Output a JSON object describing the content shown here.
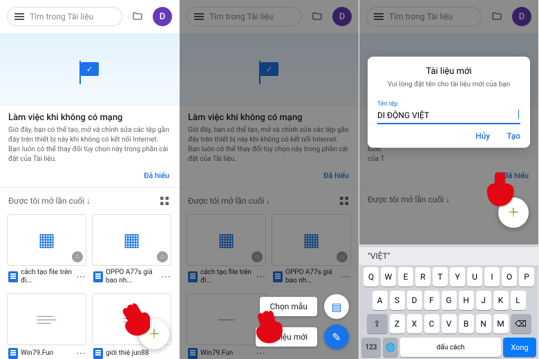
{
  "search_placeholder": "Tìm trong Tài liệu",
  "avatar_letter": "D",
  "hero": {
    "title": "Làm việc khi không có mạng",
    "body": "Giờ đây, bạn có thể tạo, mở và chỉnh sửa các tệp gần đây trên thiết bị này khi không có kết nối Internet. Bạn luôn có thể thay đổi tùy chọn này trong phần cài đặt của Tài liệu.",
    "got_it": "Đã hiểu"
  },
  "section_label": "Được tôi mở lần cuối ↓",
  "docs": [
    {
      "title": "cách tạo file trên đi..."
    },
    {
      "title": "OPPO A77s giá bao nh..."
    },
    {
      "title": "Win79.Fun"
    },
    {
      "title": "giới thiệ jun88"
    }
  ],
  "fab_menu": {
    "template": "Chọn mẫu",
    "new_doc": "Tài liệu mới"
  },
  "dialog": {
    "title": "Tài liệu mới",
    "subtitle": "Vui lòng đặt tên cho tài liệu mới của bạn",
    "field_label": "Tên tệp",
    "value": "DI ĐỘNG VIỆT",
    "cancel": "Hủy",
    "create": "Tạo"
  },
  "keyboard": {
    "suggestion": "\"VIỆT\"",
    "r1": [
      "Q",
      "W",
      "E",
      "R",
      "T",
      "Y",
      "U",
      "I",
      "O",
      "P"
    ],
    "r2": [
      "A",
      "S",
      "D",
      "F",
      "G",
      "H",
      "J",
      "K",
      "L"
    ],
    "r3": [
      "Z",
      "X",
      "C",
      "V",
      "B",
      "N",
      "M"
    ],
    "num": "123",
    "space": "dấu cách",
    "done": "Xong"
  }
}
